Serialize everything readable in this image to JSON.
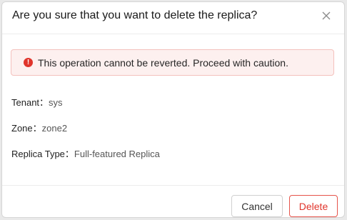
{
  "dialog": {
    "title": "Are you sure that you want to delete the replica?",
    "close_icon": "close-icon"
  },
  "alert": {
    "icon": "error-icon",
    "icon_glyph": "!",
    "message": "This operation cannot be reverted. Proceed with caution.",
    "color": "#e0342b"
  },
  "fields": {
    "tenant": {
      "label": "Tenant：",
      "value": "sys"
    },
    "zone": {
      "label": "Zone：",
      "value": "zone2"
    },
    "replica_type": {
      "label": "Replica Type：",
      "value": "Full-featured Replica"
    }
  },
  "buttons": {
    "cancel": "Cancel",
    "delete": "Delete"
  }
}
